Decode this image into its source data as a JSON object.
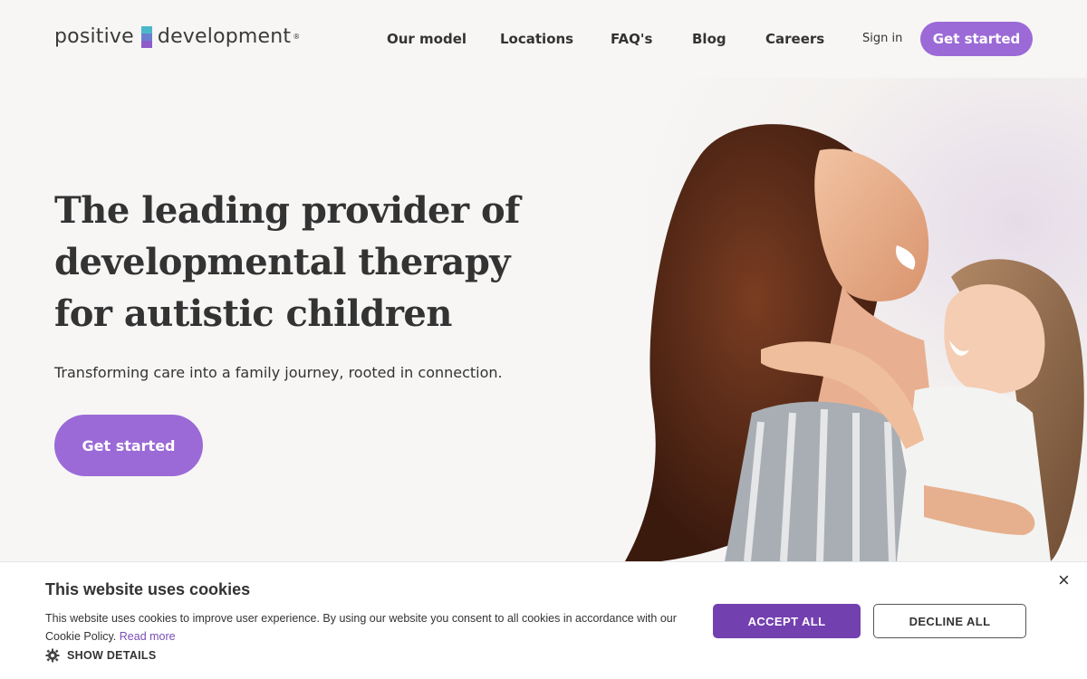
{
  "header": {
    "logo_left": "positive",
    "logo_right": "development",
    "logo_reg": "®",
    "nav": [
      "Our model",
      "Locations",
      "FAQ's",
      "Blog",
      "Careers"
    ],
    "sign_in": "Sign in",
    "cta": "Get started"
  },
  "hero": {
    "headline": "The leading provider of developmental therapy for autistic children",
    "subline": "Transforming care into a family journey, rooted in connection.",
    "cta": "Get started"
  },
  "cookie_banner": {
    "title": "This website uses cookies",
    "text": "This website uses cookies to improve user experience. By using our website you consent to all cookies in accordance with our Cookie Policy.",
    "read_more": "Read more",
    "show_details": "SHOW DETAILS",
    "accept": "ACCEPT ALL",
    "decline": "DECLINE ALL",
    "close": "×"
  },
  "colors": {
    "brand_purple": "#9b6ad7",
    "accept_purple": "#7340b0",
    "background": "#f7f6f5"
  }
}
